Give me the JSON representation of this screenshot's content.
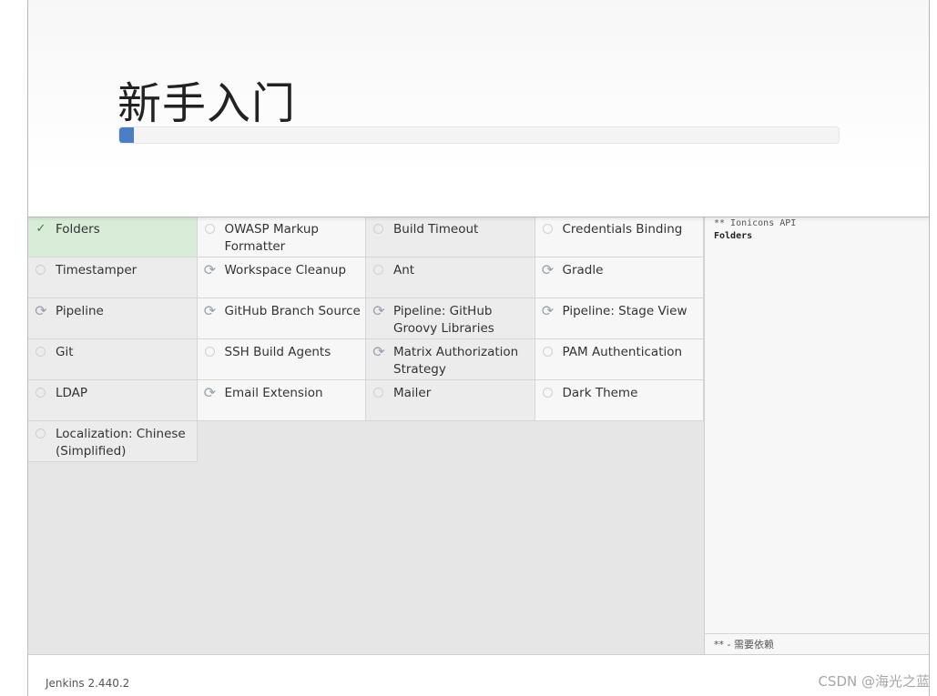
{
  "header": {
    "title": "新手入门",
    "progress": 0.02,
    "progress_color": "#4a7fc6"
  },
  "plugins": [
    {
      "name": "Folders",
      "status": "installed",
      "icon": "check-icon"
    },
    {
      "name": "OWASP Markup Formatter",
      "status": "pending",
      "icon": "circle-icon"
    },
    {
      "name": "Build Timeout",
      "status": "pending",
      "icon": "circle-icon"
    },
    {
      "name": "Credentials Binding",
      "status": "pending",
      "icon": "circle-icon"
    },
    {
      "name": "Timestamper",
      "status": "pending",
      "icon": "circle-icon"
    },
    {
      "name": "Workspace Cleanup",
      "status": "installing",
      "icon": "refresh-icon"
    },
    {
      "name": "Ant",
      "status": "pending",
      "icon": "circle-icon"
    },
    {
      "name": "Gradle",
      "status": "installing",
      "icon": "refresh-icon"
    },
    {
      "name": "Pipeline",
      "status": "installing",
      "icon": "refresh-icon"
    },
    {
      "name": "GitHub Branch Source",
      "status": "installing",
      "icon": "refresh-icon"
    },
    {
      "name": "Pipeline: GitHub Groovy Libraries",
      "status": "installing",
      "icon": "refresh-icon"
    },
    {
      "name": "Pipeline: Stage View",
      "status": "installing",
      "icon": "refresh-icon"
    },
    {
      "name": "Git",
      "status": "pending",
      "icon": "circle-icon"
    },
    {
      "name": "SSH Build Agents",
      "status": "pending",
      "icon": "circle-icon"
    },
    {
      "name": "Matrix Authorization Strategy",
      "status": "installing",
      "icon": "refresh-icon"
    },
    {
      "name": "PAM Authentication",
      "status": "pending",
      "icon": "circle-icon"
    },
    {
      "name": "LDAP",
      "status": "pending",
      "icon": "circle-icon"
    },
    {
      "name": "Email Extension",
      "status": "installing",
      "icon": "refresh-icon"
    },
    {
      "name": "Mailer",
      "status": "pending",
      "icon": "circle-icon"
    },
    {
      "name": "Dark Theme",
      "status": "pending",
      "icon": "circle-icon"
    },
    {
      "name": "Localization: Chinese (Simplified)",
      "status": "pending",
      "icon": "circle-icon"
    }
  ],
  "log": {
    "line1": "** Ionicons API",
    "line2": "Folders"
  },
  "legend": "** - 需要依赖",
  "footer": {
    "version": "Jenkins 2.440.2",
    "watermark": "CSDN @海光之蓝"
  }
}
